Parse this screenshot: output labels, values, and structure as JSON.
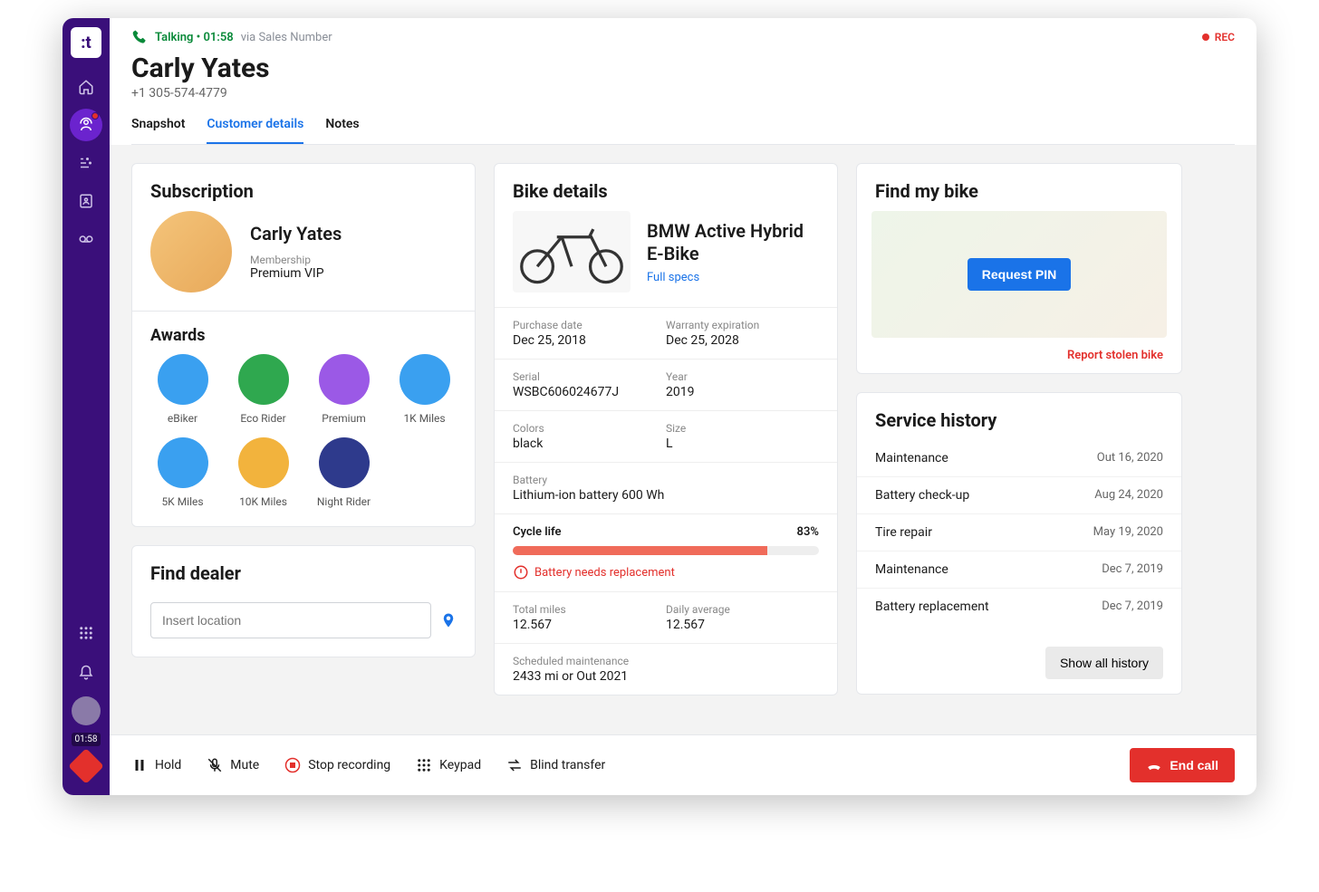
{
  "call": {
    "status_label": "Talking",
    "duration": "01:58",
    "via": "via Sales Number",
    "rec_label": "REC"
  },
  "customer": {
    "name": "Carly Yates",
    "phone": "+1 305-574-4779"
  },
  "tabs": [
    {
      "label": "Snapshot"
    },
    {
      "label": "Customer details"
    },
    {
      "label": "Notes"
    }
  ],
  "subscription": {
    "title": "Subscription",
    "name": "Carly Yates",
    "membership_label": "Membership",
    "membership_value": "Premium VIP"
  },
  "awards": {
    "title": "Awards",
    "items": [
      {
        "label": "eBiker",
        "color": "#3aa0f0"
      },
      {
        "label": "Eco Rider",
        "color": "#2fa84f"
      },
      {
        "label": "Premium",
        "color": "#9b59e6"
      },
      {
        "label": "1K Miles",
        "color": "#3aa0f0"
      },
      {
        "label": "5K Miles",
        "color": "#3aa0f0"
      },
      {
        "label": "10K Miles",
        "color": "#f2b33d"
      },
      {
        "label": "Night Rider",
        "color": "#2e3a8c"
      }
    ]
  },
  "find_dealer": {
    "title": "Find dealer",
    "placeholder": "Insert location"
  },
  "bike": {
    "title": "Bike details",
    "model": "BMW Active Hybrid E-Bike",
    "full_specs": "Full specs",
    "purchase_date_label": "Purchase date",
    "purchase_date": "Dec 25, 2018",
    "warranty_label": "Warranty expiration",
    "warranty": "Dec 25, 2028",
    "serial_label": "Serial",
    "serial": "WSBC606024677J",
    "year_label": "Year",
    "year": "2019",
    "colors_label": "Colors",
    "colors": "black",
    "size_label": "Size",
    "size": "L",
    "battery_label": "Battery",
    "battery": "Lithium-ion battery 600 Wh",
    "cycle_label": "Cycle life",
    "cycle_pct": "83%",
    "warn": "Battery needs replacement",
    "total_miles_label": "Total miles",
    "total_miles": "12.567",
    "daily_avg_label": "Daily average",
    "daily_avg": "12.567",
    "sched_label": "Scheduled maintenance",
    "sched": "2433 mi or Out 2021"
  },
  "find_bike": {
    "title": "Find my bike",
    "request_pin": "Request PIN",
    "report_stolen": "Report stolen bike"
  },
  "service": {
    "title": "Service history",
    "items": [
      {
        "name": "Maintenance",
        "date": "Out 16, 2020"
      },
      {
        "name": "Battery check-up",
        "date": "Aug 24, 2020"
      },
      {
        "name": "Tire repair",
        "date": "May 19, 2020"
      },
      {
        "name": "Maintenance",
        "date": "Dec 7, 2019"
      },
      {
        "name": "Battery replacement",
        "date": "Dec 7, 2019"
      }
    ],
    "show_all": "Show all history"
  },
  "callbar": {
    "hold": "Hold",
    "mute": "Mute",
    "stop_rec": "Stop recording",
    "keypad": "Keypad",
    "blind_transfer": "Blind transfer",
    "end_call": "End call"
  },
  "sidebar_timer": "01:58"
}
